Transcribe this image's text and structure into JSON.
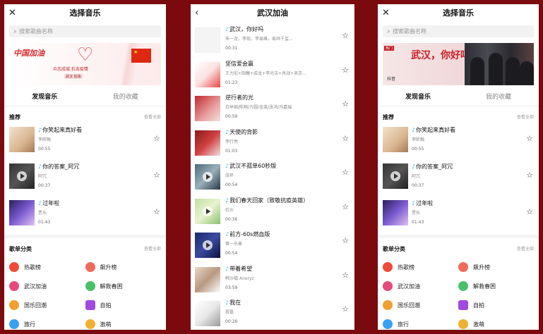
{
  "screen1": {
    "title": "选择音乐",
    "close_icon": "close-icon",
    "search_placeholder": "搜索歌曲名称",
    "banner": {
      "logo": "中国加油",
      "slogan1": "众志成城  抗击疫情",
      "slogan2": "武汉  加油"
    },
    "tabs": [
      {
        "label": "发现音乐",
        "active": true
      },
      {
        "label": "我的收藏",
        "active": false
      }
    ],
    "recommend": {
      "title": "推荐",
      "more": "查看全部"
    },
    "songs": [
      {
        "title": "你笑起来真好看",
        "artist": "李昕融",
        "duration": "00:55"
      },
      {
        "title": "你的答案_阿冗",
        "artist": "阿冗",
        "duration": "00:37"
      },
      {
        "title": "过年啦",
        "artist": "贾乐",
        "duration": "01:43"
      }
    ],
    "categories_header": {
      "title": "歌单分类",
      "more": "查看全部"
    },
    "categories": [
      {
        "label": "热歌榜",
        "color": "#f04a3a"
      },
      {
        "label": "飙升榜",
        "color": "#f06a5a"
      },
      {
        "label": "武汉加油",
        "color": "#e64a7a"
      },
      {
        "label": "解救春困",
        "color": "#4ac06a"
      },
      {
        "label": "国乐回潮",
        "color": "#f0a030"
      },
      {
        "label": "自拍",
        "color": "#a04ae0"
      },
      {
        "label": "旅行",
        "color": "#3aa0f0"
      },
      {
        "label": "激萌",
        "color": "#f0b030"
      }
    ]
  },
  "screen2": {
    "title": "武汉加油",
    "back_icon": "back-arrow-icon",
    "songs": [
      {
        "title": "武汉，你好吗",
        "artist": "朱一龙，李现，李易峰，易烊千玺...",
        "duration": "00:31"
      },
      {
        "title": "坚信爱会赢",
        "artist": "王力宏+田馥+成龙+李光洁+肖战+吴京...",
        "duration": "01:23"
      },
      {
        "title": "逆行者的光",
        "artist": "白举纲/陈翔/方圆/金莱/张鸿/冯嘉瑞",
        "duration": "00:59"
      },
      {
        "title": "天使的背影",
        "artist": "李行亮",
        "duration": "01:03"
      },
      {
        "title": "武汉不孤单60秒版",
        "artist": "张怀",
        "duration": "00:54"
      },
      {
        "title": "我们春天回家（致敬抗疫英雄）",
        "artist": "石头",
        "duration": "00:36"
      },
      {
        "title": "前方-60s燃血版",
        "artist": "第一乐章",
        "duration": "00:54"
      },
      {
        "title": "带着希望",
        "artist": "韩沙楢 Aneryz",
        "duration": "03:59"
      },
      {
        "title": "我在",
        "artist": "胥磊",
        "duration": "00:26"
      }
    ]
  },
  "screen3": {
    "title": "选择音乐",
    "close_icon": "close-icon",
    "search_placeholder": "搜索歌曲名称",
    "banner": {
      "headline": "武汉，你好吗",
      "tag": "热门",
      "brand": "抖音"
    },
    "tabs": [
      {
        "label": "发现音乐",
        "active": true
      },
      {
        "label": "我的收藏",
        "active": false
      }
    ],
    "recommend": {
      "title": "推荐",
      "more": "查看全部"
    },
    "songs": [
      {
        "title": "你笑起来真好看",
        "artist": "李昕融",
        "duration": "00:55"
      },
      {
        "title": "你的答案_阿冗",
        "artist": "阿冗",
        "duration": "00:37"
      },
      {
        "title": "过年啦",
        "artist": "贾乐",
        "duration": "01:43"
      }
    ],
    "categories_header": {
      "title": "歌单分类",
      "more": "查看全部"
    },
    "categories": [
      {
        "label": "热歌榜",
        "color": "#f04a3a"
      },
      {
        "label": "飙升榜",
        "color": "#f06a5a"
      },
      {
        "label": "武汉加油",
        "color": "#e64a7a"
      },
      {
        "label": "解救春困",
        "color": "#4ac06a"
      },
      {
        "label": "国乐回潮",
        "color": "#f0a030"
      },
      {
        "label": "自拍",
        "color": "#a04ae0"
      },
      {
        "label": "旅行",
        "color": "#3aa0f0"
      },
      {
        "label": "激萌",
        "color": "#f0b030"
      }
    ]
  }
}
